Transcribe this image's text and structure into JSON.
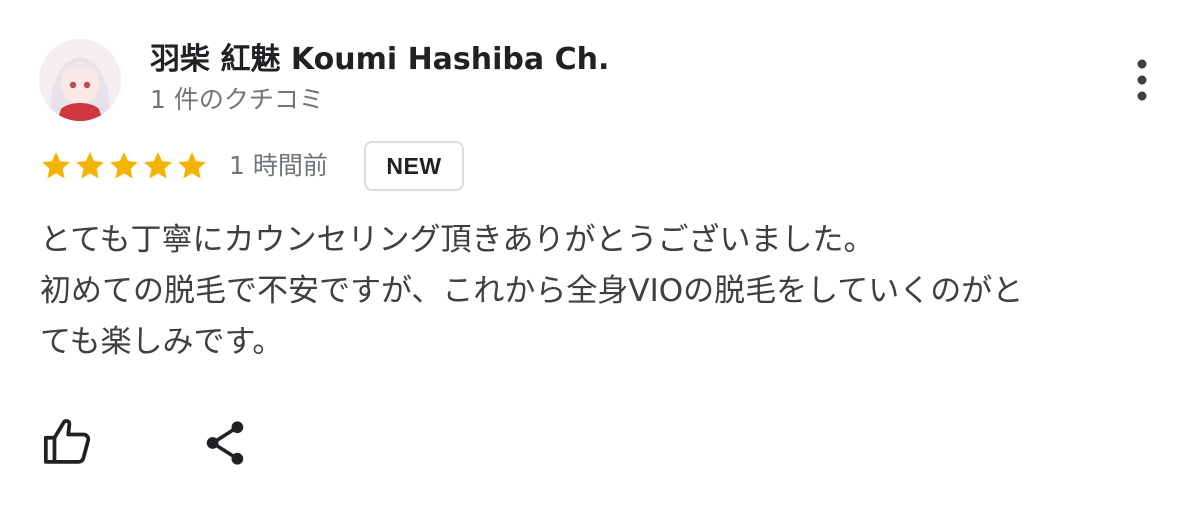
{
  "reviewer": {
    "name": "羽柴 紅魅 Koumi Hashiba Ch.",
    "review_count": "1 件のクチコミ",
    "avatar_icon": "avatar-image"
  },
  "rating": {
    "stars": 5,
    "max_stars": 5,
    "star_color": "#f4b400",
    "time_ago": "1 時間前",
    "badge": "NEW"
  },
  "review": {
    "lines": [
      "とても丁寧にカウンセリング頂きありがとうございました。",
      "初めての脱毛で不安ですが、これから全身VIOの脱毛をしていくのがと",
      "ても楽しみです。"
    ]
  },
  "actions": {
    "like_icon": "thumbs-up-icon",
    "share_icon": "share-icon",
    "more_icon": "more-vert-icon"
  }
}
